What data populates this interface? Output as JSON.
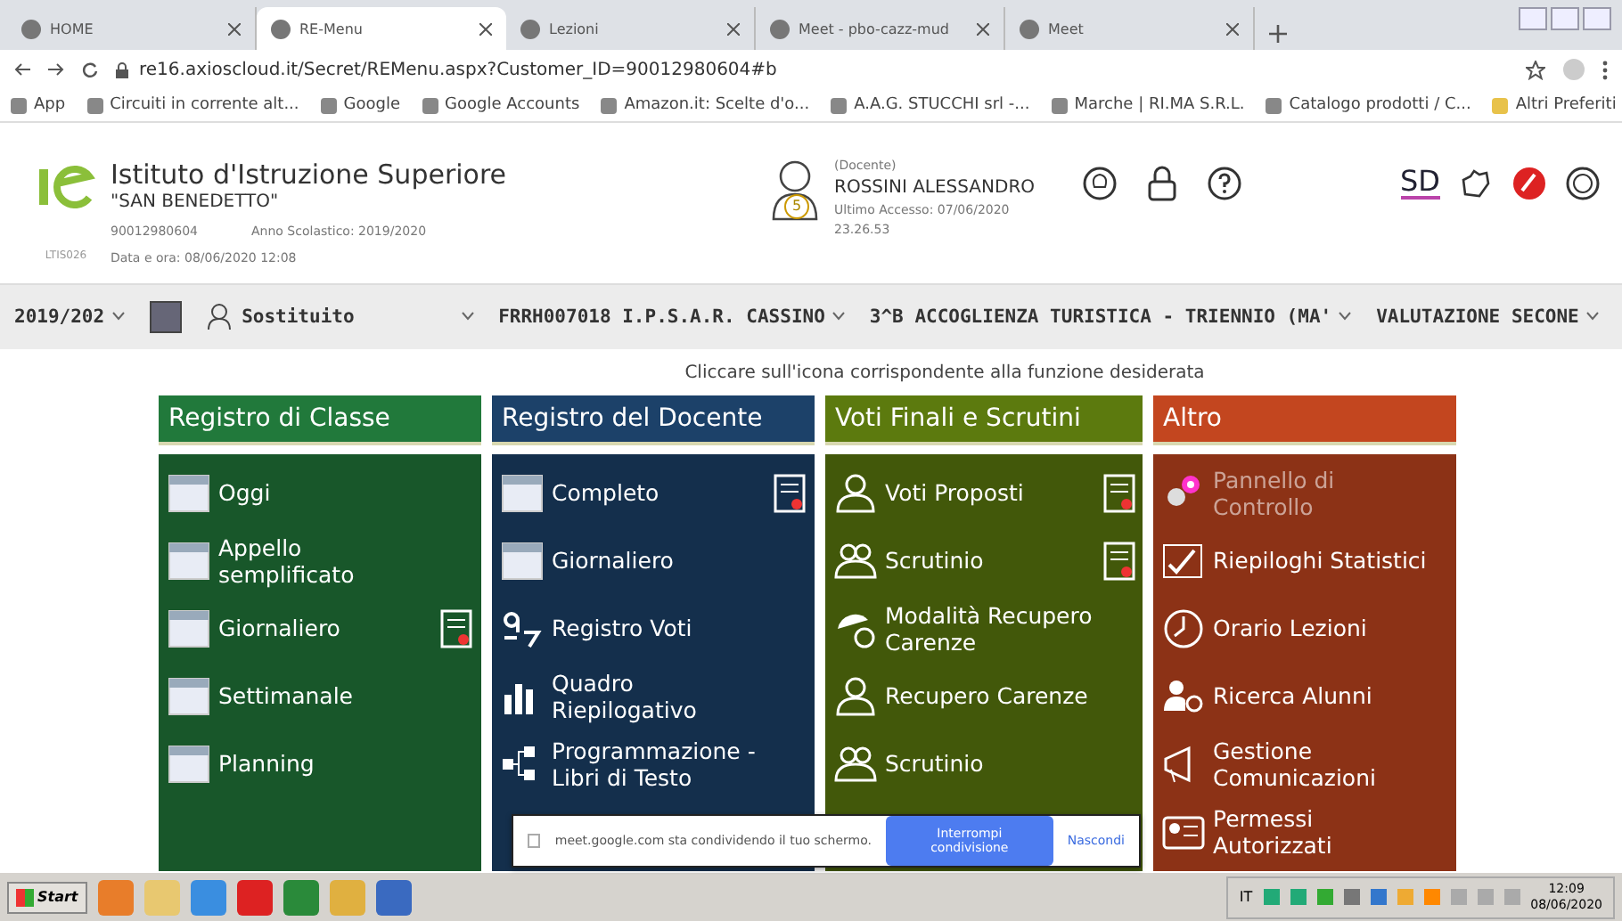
{
  "browser": {
    "tabs": [
      {
        "title": "HOME",
        "selected": false
      },
      {
        "title": "RE-Menu",
        "selected": true
      },
      {
        "title": "Lezioni",
        "selected": false
      },
      {
        "title": "Meet - pbo-cazz-mud",
        "selected": false
      },
      {
        "title": "Meet",
        "selected": false
      }
    ],
    "url": "re16.axioscloud.it/Secret/REMenu.aspx?Customer_ID=90012980604#b",
    "bookmarks": [
      "App",
      "Circuiti in corrente alt...",
      "Google",
      "Google Accounts",
      "Amazon.it: Scelte d'o...",
      "A.A.G. STUCCHI srl -...",
      "Marche | RI.MA S.R.L.",
      "Catalogo prodotti / C..."
    ],
    "other_bookmarks": "Altri Preferiti"
  },
  "header": {
    "logo_caption": "LTIS026",
    "school_line1": "Istituto d'Istruzione Superiore",
    "school_line2": "\"SAN BENEDETTO\"",
    "code": "90012980604",
    "school_year": "Anno Scolastico: 2019/2020",
    "datetime": "Data e ora: 08/06/2020 12:08",
    "avatar_badge": "5",
    "role": "(Docente)",
    "user": "ROSSINI ALESSANDRO",
    "last_access": "Ultimo Accesso: 07/06/2020",
    "last_access_time": "23.26.53",
    "sd_logo": "SD"
  },
  "navbar": [
    {
      "kind": "dropdown",
      "label": "2019/202"
    },
    {
      "kind": "icon"
    },
    {
      "kind": "dropdown",
      "label": "Sostituito"
    },
    {
      "kind": "dropdown",
      "label": "FRRH007018 I.P.S.A.R. CASSINO"
    },
    {
      "kind": "dropdown",
      "label": "3^B ACCOGLIENZA TURISTICA - TRIENNIO (MA'"
    },
    {
      "kind": "dropdown",
      "label": "VALUTAZIONE SECONE"
    }
  ],
  "instruction": "Cliccare sull'icona corrispondente alla funzione desiderata",
  "columns": [
    {
      "title": "Registro di Classe",
      "color": "#21793b",
      "items": [
        {
          "label": "Oggi",
          "disabled": false,
          "side_icon": false
        },
        {
          "label": "Appello semplificato",
          "disabled": false,
          "side_icon": false
        },
        {
          "label": "Giornaliero",
          "disabled": false,
          "side_icon": true
        },
        {
          "label": "Settimanale",
          "disabled": false,
          "side_icon": false
        },
        {
          "label": "Planning",
          "disabled": false,
          "side_icon": false
        }
      ]
    },
    {
      "title": "Registro del Docente",
      "color": "#1c4169",
      "items": [
        {
          "label": "Completo",
          "disabled": false,
          "side_icon": true
        },
        {
          "label": "Giornaliero",
          "disabled": false,
          "side_icon": false
        },
        {
          "label": "Registro Voti",
          "disabled": false,
          "side_icon": false
        },
        {
          "label": "Quadro Riepilogativo",
          "disabled": false,
          "side_icon": false
        },
        {
          "label": "Programmazione - Libri di Testo",
          "disabled": false,
          "side_icon": false
        }
      ]
    },
    {
      "title": "Voti Finali e Scrutini",
      "color": "#5c7a0e",
      "items": [
        {
          "label": "Voti Proposti",
          "disabled": false,
          "side_icon": true
        },
        {
          "label": "Scrutinio",
          "disabled": false,
          "side_icon": true
        },
        {
          "label": "Modalità Recupero Carenze",
          "disabled": false,
          "side_icon": false
        },
        {
          "label": "Recupero Carenze",
          "disabled": false,
          "side_icon": false
        },
        {
          "label": "Scrutinio",
          "disabled": false,
          "side_icon": false
        }
      ]
    },
    {
      "title": "Altro",
      "color": "#c3461f",
      "items": [
        {
          "label": "Pannello di Controllo",
          "disabled": true,
          "side_icon": false
        },
        {
          "label": "Riepiloghi Statistici",
          "disabled": false,
          "side_icon": false
        },
        {
          "label": "Orario Lezioni",
          "disabled": false,
          "side_icon": false
        },
        {
          "label": "Ricerca Alunni",
          "disabled": false,
          "side_icon": false
        },
        {
          "label": "Gestione Comunicazioni",
          "disabled": false,
          "side_icon": false
        },
        {
          "label": "Permessi Autorizzati",
          "disabled": false,
          "side_icon": false
        }
      ]
    }
  ],
  "share_bar": {
    "message": "meet.google.com sta condividendo il tuo schermo.",
    "stop_button": "Interrompi condivisione",
    "hide_link": "Nascondi"
  },
  "taskbar": {
    "start": "Start",
    "language": "IT",
    "time": "12:09",
    "date": "08/06/2020"
  }
}
